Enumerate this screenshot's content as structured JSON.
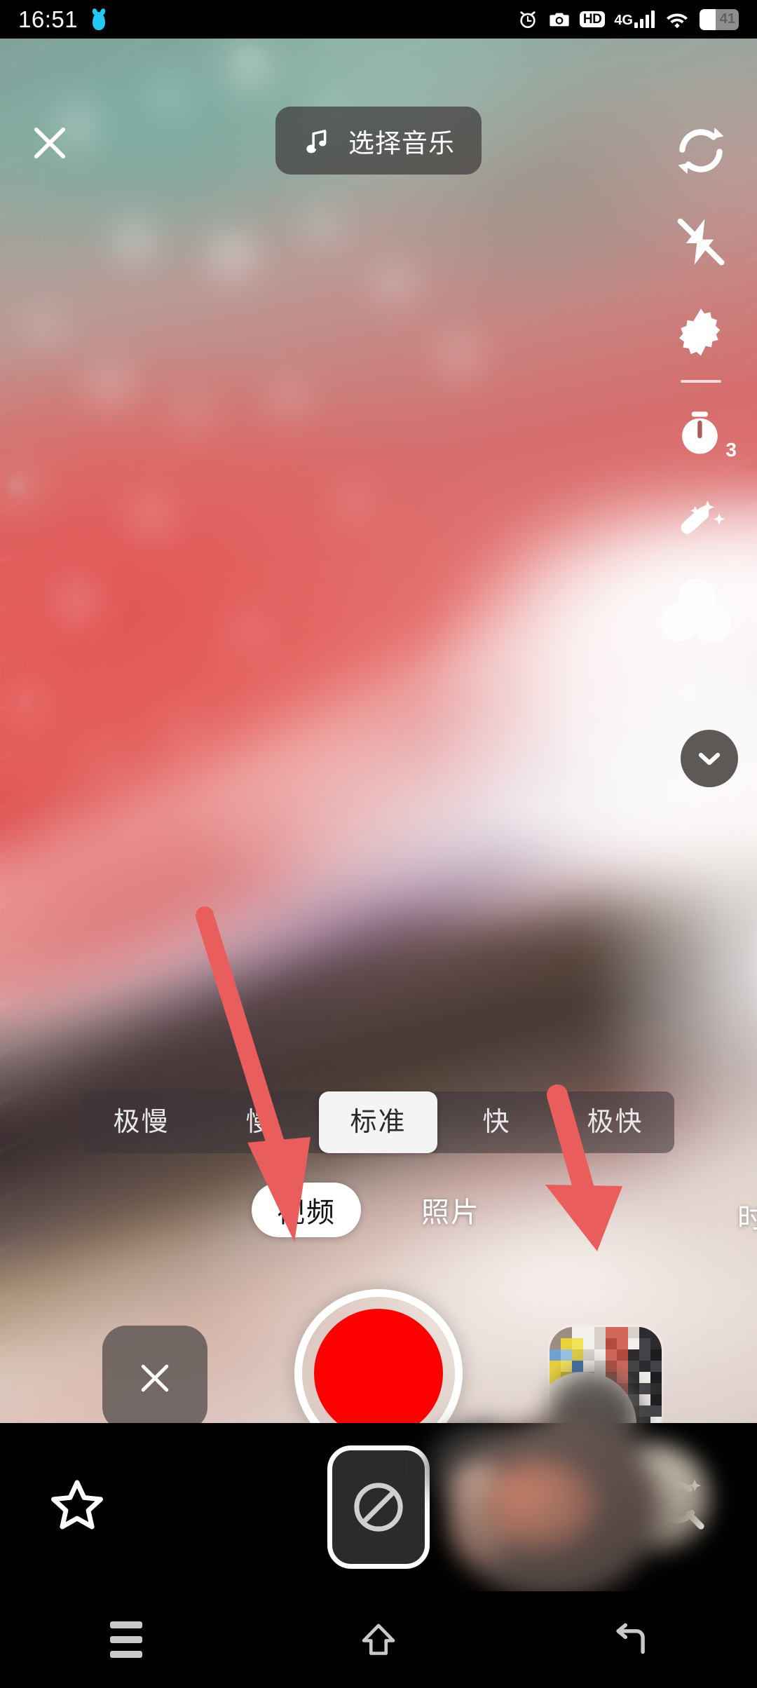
{
  "status_bar": {
    "time": "16:51",
    "qq_icon": "qq-penguin-icon",
    "icons": [
      "alarm-clock-icon",
      "camera-icon",
      "hd-icon",
      "4g-signal-icon",
      "wifi-icon",
      "battery-icon"
    ],
    "hd_label": "HD",
    "network_label": "4G",
    "battery_level": "41"
  },
  "camera": {
    "close_label": "✕",
    "music_button": {
      "icon": "music-note-icon",
      "label": "选择音乐"
    },
    "rail": [
      {
        "name": "switch-camera",
        "icon": "camera-flip-icon"
      },
      {
        "name": "flash",
        "icon": "flash-off-icon"
      },
      {
        "name": "settings",
        "icon": "gear-icon"
      },
      {
        "name": "timer",
        "icon": "timer-icon",
        "badge": "3"
      },
      {
        "name": "beauty",
        "icon": "magic-wand-icon"
      },
      {
        "name": "filters",
        "icon": "filter-circles-icon"
      }
    ],
    "collapse_button": {
      "icon": "chevron-down-icon"
    },
    "speed_options": [
      {
        "label": "极慢",
        "selected": false
      },
      {
        "label": "慢",
        "selected": false
      },
      {
        "label": "标准",
        "selected": true
      },
      {
        "label": "快",
        "selected": false
      },
      {
        "label": "极快",
        "selected": false
      }
    ],
    "modes": [
      {
        "label": "视频",
        "selected": true
      },
      {
        "label": "照片",
        "selected": false
      },
      {
        "label": "时",
        "selected": false,
        "clipped": true
      }
    ],
    "shutter": {
      "name": "record-button",
      "color": "#fb0200"
    },
    "delete_button": {
      "label": "✕"
    },
    "gallery_thumbnail": {
      "name": "gallery-thumbnail"
    }
  },
  "annotations": {
    "color": "#ea5d5d",
    "arrows": [
      {
        "name": "arrow-to-record-button",
        "points_to": "record-button"
      },
      {
        "name": "arrow-to-gallery-thumbnail",
        "points_to": "gallery-thumbnail"
      }
    ]
  },
  "bottom_bar": {
    "favorite": {
      "icon": "star-icon"
    },
    "block": {
      "icon": "no-entry-icon"
    },
    "search": {
      "icon": "search-sparkle-icon"
    }
  },
  "nav_bar": {
    "recents": {
      "icon": "menu-icon"
    },
    "home": {
      "icon": "home-icon"
    },
    "back": {
      "icon": "back-arrow-icon"
    }
  },
  "theme": {
    "accent_red": "#fb0200",
    "annotation_red": "#ea5d5d",
    "bar_black": "#000000",
    "selected_white": "#ffffff"
  }
}
